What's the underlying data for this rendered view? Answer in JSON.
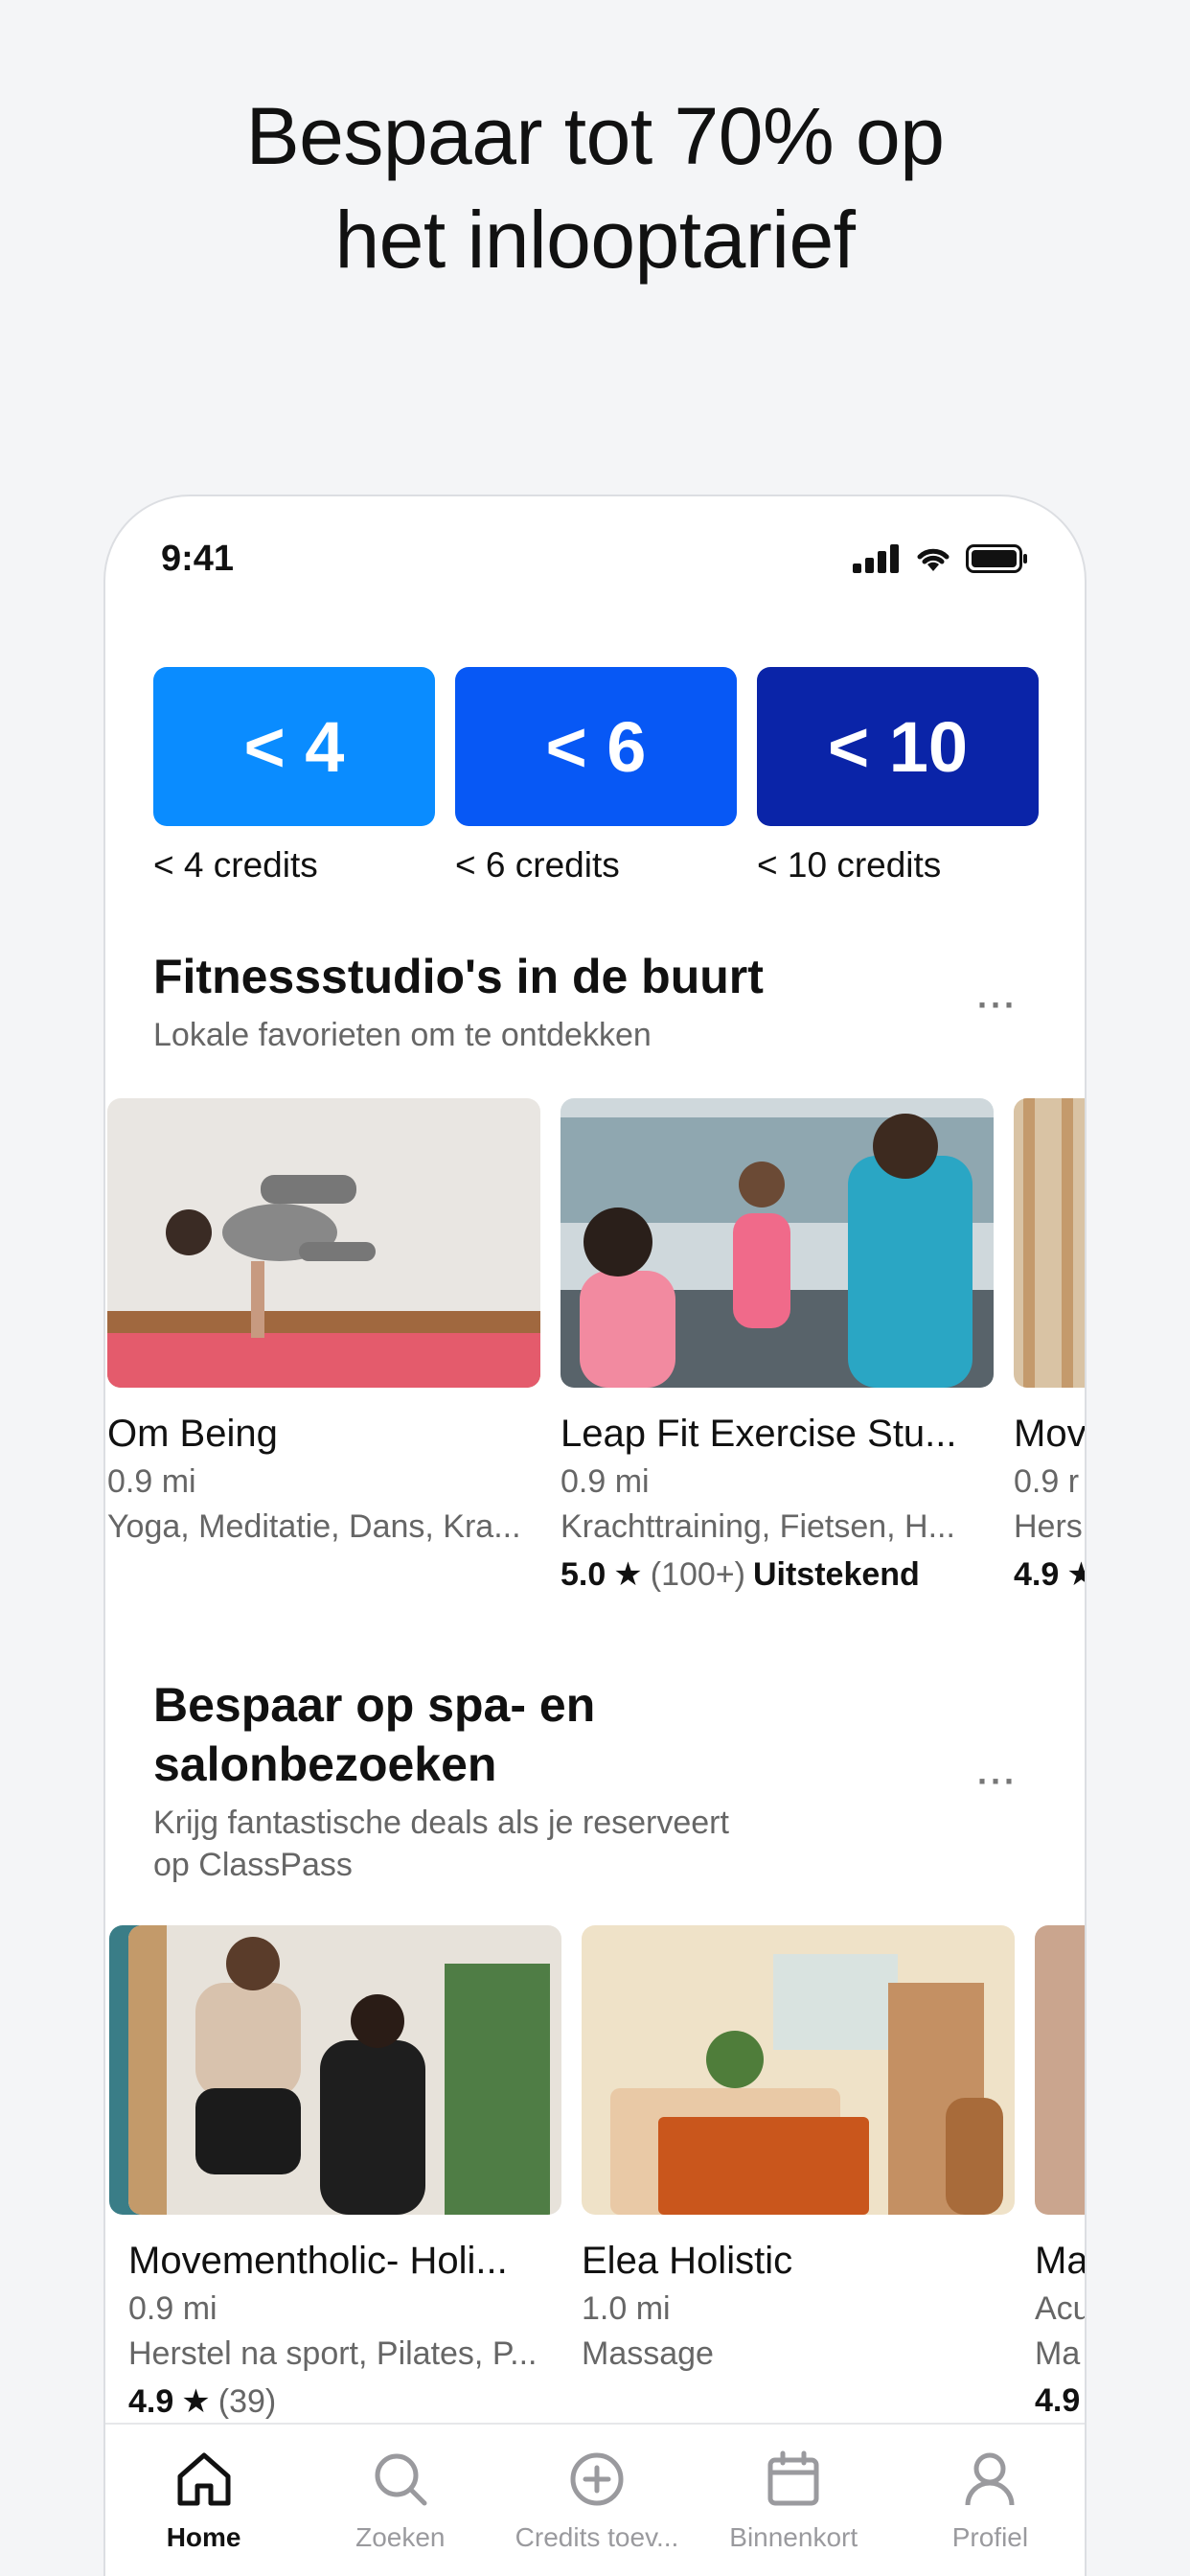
{
  "headline": {
    "line1": "Bespaar tot 70% op",
    "line2": "het inlooptarief"
  },
  "status_bar": {
    "time": "9:41"
  },
  "credit_filters": [
    {
      "tile": "< 4",
      "caption": "< 4 credits",
      "color": "#0a8cff"
    },
    {
      "tile": "< 6",
      "caption": "< 6 credits",
      "color": "#0758f5"
    },
    {
      "tile": "< 10",
      "caption": "< 10 credits",
      "color": "#0a24a8"
    }
  ],
  "section1": {
    "title": "Fitnessstudio's in de buurt",
    "subtitle": "Lokale favorieten om te ontdekken",
    "more": "···",
    "cards": [
      {
        "name": "Om Being",
        "distance": "0.9 mi",
        "tags": "Yoga, Meditatie, Dans, Kra..."
      },
      {
        "name": "Leap Fit Exercise Stu...",
        "distance": "0.9 mi",
        "tags": "Krachttraining, Fietsen, H...",
        "score": "5.0",
        "count": "(100+)",
        "label": "Uitstekend"
      },
      {
        "name": "Mov",
        "distance": "0.9 r",
        "tags": "Hers",
        "score": "4.9"
      }
    ]
  },
  "section2": {
    "title_line1": "Bespaar op spa- en",
    "title_line2": "salonbezoeken",
    "subtitle_line1": "Krijg fantastische deals als je reserveert",
    "subtitle_line2": "op ClassPass",
    "more": "···",
    "cards": [
      {
        "name": "Movementholic- Holi...",
        "distance": "0.9 mi",
        "tags": "Herstel na sport, Pilates, P...",
        "score": "4.9",
        "count": "(39)"
      },
      {
        "name": "Elea Holistic",
        "distance": "1.0 mi",
        "tags": "Massage"
      },
      {
        "name": "Ma",
        "distance": "Acu",
        "tags": "Ma",
        "score": "4.9"
      }
    ]
  },
  "tabbar": [
    {
      "label": "Home",
      "icon": "home-icon",
      "active": true
    },
    {
      "label": "Zoeken",
      "icon": "search-icon"
    },
    {
      "label": "Credits toev...",
      "icon": "add-circle-icon"
    },
    {
      "label": "Binnenkort",
      "icon": "calendar-icon"
    },
    {
      "label": "Profiel",
      "icon": "profile-icon"
    }
  ]
}
